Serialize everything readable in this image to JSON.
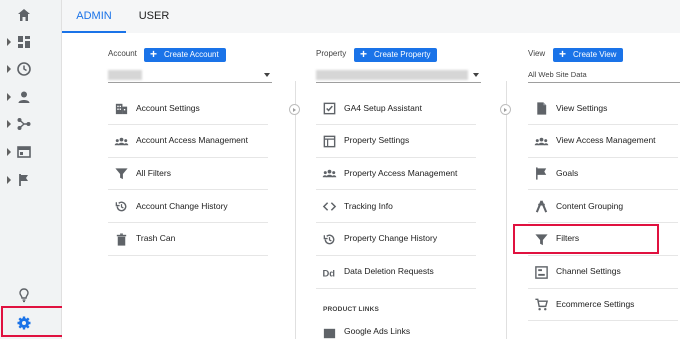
{
  "tabs": [
    {
      "label": "ADMIN"
    },
    {
      "label": "USER"
    }
  ],
  "account": {
    "label": "Account",
    "button": "Create Account"
  },
  "property": {
    "label": "Property",
    "button": "Create Property"
  },
  "view": {
    "label": "View",
    "button": "Create View",
    "selected": "All Web Site Data"
  },
  "account_items": [
    {
      "label": "Account Settings",
      "icon": "building-icon"
    },
    {
      "label": "Account Access Management",
      "icon": "people-icon"
    },
    {
      "label": "All Filters",
      "icon": "filter-icon"
    },
    {
      "label": "Account Change History",
      "icon": "history-icon"
    },
    {
      "label": "Trash Can",
      "icon": "trash-icon"
    }
  ],
  "property_items": [
    {
      "label": "GA4 Setup Assistant",
      "icon": "checkbox-icon"
    },
    {
      "label": "Property Settings",
      "icon": "window-icon"
    },
    {
      "label": "Property Access Management",
      "icon": "people-icon"
    },
    {
      "label": "Tracking Info",
      "icon": "code-icon"
    },
    {
      "label": "Property Change History",
      "icon": "history-icon"
    },
    {
      "label": "Data Deletion Requests",
      "icon": "dd-icon"
    }
  ],
  "product_links": {
    "title": "PRODUCT LINKS",
    "first": "Google Ads Links"
  },
  "view_items": [
    {
      "label": "View Settings",
      "icon": "document-icon"
    },
    {
      "label": "View Access Management",
      "icon": "people-icon"
    },
    {
      "label": "Goals",
      "icon": "flag-icon"
    },
    {
      "label": "Content Grouping",
      "icon": "grouping-icon"
    },
    {
      "label": "Filters",
      "icon": "filter-icon"
    },
    {
      "label": "Channel Settings",
      "icon": "channel-icon"
    },
    {
      "label": "Ecommerce Settings",
      "icon": "cart-icon"
    }
  ],
  "colors": {
    "accent": "#1a73e8",
    "highlight": "#e0113f"
  }
}
